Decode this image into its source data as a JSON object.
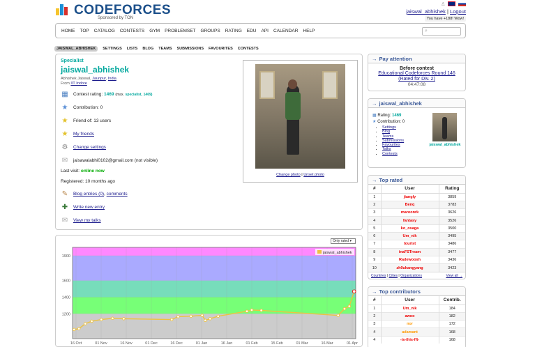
{
  "header": {
    "logo_text": "CODEFORCES",
    "sponsor_text": "Sponsored by TON",
    "user_handle": "jaiswal_abhishek",
    "separator": "|",
    "logout_label": "Logout",
    "notice_text": "You have +188! Wow!",
    "flags": [
      "en-flag",
      "ru-flag"
    ]
  },
  "menu": {
    "items": [
      "HOME",
      "TOP",
      "CATALOG",
      "CONTESTS",
      "GYM",
      "PROBLEMSET",
      "GROUPS",
      "RATING",
      "EDU",
      "API",
      "CALENDAR",
      "HELP"
    ],
    "search_placeholder": ""
  },
  "submenu": {
    "items": [
      "JAISWAL_ABHISHEK",
      "SETTINGS",
      "LISTS",
      "BLOG",
      "TEAMS",
      "SUBMISSIONS",
      "FAVOURITES",
      "CONTESTS"
    ],
    "active_index": 0
  },
  "profile": {
    "rank": "Specialist",
    "handle": "jaiswal_abhishek",
    "real_name": "Abhishek Jaiswal,",
    "city": "Jaunpur",
    "country": "India",
    "from_label": "From",
    "org": "IIT Indore",
    "rating_label": "Contest rating:",
    "rating_value": "1469",
    "rating_max_prefix": "(max.",
    "rating_max_rank": "specialist,",
    "rating_max_value": "1469)",
    "contribution_label": "Contribution:",
    "contribution_value": "0",
    "friend_of": "Friend of: 13 users",
    "my_friends": "My friends",
    "change_settings": "Change settings",
    "email": "jaisawalabhi0102@gmail.com (not visible)",
    "last_visit_label": "Last visit:",
    "last_visit_value": "online now",
    "registered": "Registered: 10 months ago",
    "blog_entries": "Blog entries (0)",
    "comments": "comments",
    "write_entry": "Write new entry",
    "my_talks": "View my talks",
    "change_photo": "Change photo",
    "unset_photo": "Unset photo",
    "photo_sep": "|"
  },
  "chart_filter": "Only rated",
  "chart_data": {
    "type": "line",
    "series": [
      {
        "name": "jaiswal_abhishek",
        "color": "#edc240",
        "x": [
          "2022-10-16",
          "2022-10-19",
          "2022-10-23",
          "2022-10-27",
          "2022-11-02",
          "2022-11-09",
          "2022-11-16",
          "2022-12-16",
          "2022-12-20",
          "2022-12-28",
          "2023-01-04",
          "2023-01-06",
          "2023-01-09",
          "2023-01-14",
          "2023-02-01",
          "2023-02-04",
          "2023-02-10",
          "2023-03-30",
          "2023-04-03",
          "2023-04-06",
          "2023-04-09"
        ],
        "values": [
          1010,
          1020,
          1080,
          1110,
          1130,
          1145,
          1140,
          1130,
          1165,
          1170,
          1180,
          1120,
          1140,
          1170,
          1230,
          1245,
          1240,
          1180,
          1260,
          1290,
          1469
        ]
      }
    ],
    "ylim": [
      900,
      2000
    ],
    "yticks": [
      1200,
      1400,
      1600,
      1900
    ],
    "xticks": [
      "16 Oct 2022",
      "01 Nov 2022",
      "16 Nov 2022",
      "01 Dec 2022",
      "16 Dec 2022",
      "01 Jan 2023",
      "16 Jan 2023",
      "01 Feb 2023",
      "15 Feb 2023",
      "01 Mar 2023",
      "16 Mar 2023",
      "01 Apr 2023"
    ],
    "xlim": [
      "2022-10-15",
      "2023-04-10"
    ],
    "bands": [
      {
        "from": 900,
        "to": 1200,
        "color": "#cccccc"
      },
      {
        "from": 1200,
        "to": 1400,
        "color": "#77ff77"
      },
      {
        "from": 1400,
        "to": 1600,
        "color": "#77ddbb"
      },
      {
        "from": 1600,
        "to": 1900,
        "color": "#aaaaff"
      },
      {
        "from": 1900,
        "to": 2000,
        "color": "#ff88ff"
      }
    ],
    "legend_position": "top-right",
    "grid": true
  },
  "sidebar": {
    "pay": {
      "title": "Pay attention",
      "before": "Before contest",
      "contest": "Educational Codeforces Round 146 (Rated for Div. 2)",
      "timer": "04:47:08"
    },
    "mini": {
      "title": "jaiswal_abhishek",
      "rating_label": "Rating:",
      "rating_value": "1469",
      "contribution_label": "Contribution:",
      "contribution_value": "0",
      "links": [
        "Settings",
        "Blog",
        "Teams",
        "Submissions",
        "Favourites",
        "Talks",
        "Contests"
      ],
      "thumb_name": "jaiswal_abhishek"
    },
    "top_rated": {
      "title": "Top rated",
      "headers": [
        "#",
        "User",
        "Rating"
      ],
      "rows": [
        {
          "n": "1",
          "user": "jiangly",
          "first": "j",
          "rest": "iangly",
          "val": "3859"
        },
        {
          "n": "2",
          "user": "Benq",
          "first": "B",
          "rest": "enq",
          "val": "3783"
        },
        {
          "n": "3",
          "user": "maroonrk",
          "first": "m",
          "rest": "aroonrk",
          "val": "3626"
        },
        {
          "n": "4",
          "user": "fantasy",
          "first": "f",
          "rest": "antasy",
          "val": "3526"
        },
        {
          "n": "5",
          "user": "ko_osaga",
          "first": "k",
          "rest": "o_osaga",
          "val": "3500"
        },
        {
          "n": "6",
          "user": "Um_nik",
          "first": "U",
          "rest": "m_nik",
          "val": "3495"
        },
        {
          "n": "7",
          "user": "tourist",
          "first": "t",
          "rest": "ourist",
          "val": "3486"
        },
        {
          "n": "8",
          "user": "inaFSTream",
          "first": "i",
          "rest": "naFSTream",
          "val": "3477"
        },
        {
          "n": "9",
          "user": "Radewoosh",
          "first": "R",
          "rest": "adewoosh",
          "val": "3436"
        },
        {
          "n": "10",
          "user": "zh0ukangyang",
          "first": "z",
          "rest": "h0ukangyang",
          "val": "3423"
        }
      ],
      "footer_links": [
        "Countries",
        "Cities",
        "Organizations"
      ],
      "footer_sep": "|",
      "view_all": "View all →"
    },
    "top_contrib": {
      "title": "Top contributors",
      "headers": [
        "#",
        "User",
        "Contrib."
      ],
      "rows": [
        {
          "n": "1",
          "user": "Um_nik",
          "val": "184",
          "color": "red"
        },
        {
          "n": "2",
          "user": "awoo",
          "val": "182",
          "color": "red"
        },
        {
          "n": "3",
          "user": "nor",
          "val": "172",
          "color": "orange"
        },
        {
          "n": "4",
          "user": "adamant",
          "val": "168",
          "color": "orange"
        },
        {
          "n": "4",
          "user": "-is-this-fft-",
          "val": "168",
          "color": "red"
        }
      ]
    }
  }
}
